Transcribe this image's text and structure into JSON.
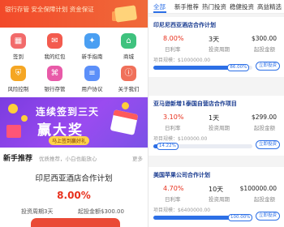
{
  "banner": {
    "slogan": "银行存管 安全保障计划 资金保证"
  },
  "icons": [
    {
      "label": "签到",
      "icon": "calendar-icon",
      "color": "#f26b6b",
      "glyph": "▦"
    },
    {
      "label": "我的红包",
      "icon": "red-packet-icon",
      "color": "#f35b4e",
      "glyph": "✉"
    },
    {
      "label": "新手指南",
      "icon": "guide-icon",
      "color": "#4a9ff2",
      "glyph": "✦"
    },
    {
      "label": "商城",
      "icon": "shop-icon",
      "color": "#3fc27e",
      "glyph": "⌂"
    },
    {
      "label": "风险控制",
      "icon": "shield-icon",
      "color": "#f5a623",
      "glyph": "⛨"
    },
    {
      "label": "银行存管",
      "icon": "bank-icon",
      "color": "#e85aa8",
      "glyph": "⌘"
    },
    {
      "label": "用户协议",
      "icon": "document-icon",
      "color": "#5b8ff9",
      "glyph": "≡"
    },
    {
      "label": "关于我们",
      "icon": "info-icon",
      "color": "#f0705a",
      "glyph": "ⓘ"
    }
  ],
  "promo": {
    "line1": "连续签到三天",
    "line2": "赢大奖",
    "badge": "马上签到赢好礼"
  },
  "recommend": {
    "title": "新手推荐",
    "subtitle": "优质推荐，小白也能放心",
    "more": "更多",
    "name": "印尼西亚酒店合作计划",
    "rate": "8.00%",
    "period": "投资周期3天",
    "min_amount": "起投金额$300.00"
  },
  "tabs": [
    {
      "label": "全部",
      "active": true
    },
    {
      "label": "新手推荐",
      "active": false
    },
    {
      "label": "热门投资",
      "active": false
    },
    {
      "label": "稳健投资",
      "active": false
    },
    {
      "label": "高益精选",
      "active": false
    }
  ],
  "products": [
    {
      "title": "印尼尼西亚酒店合作计划",
      "rate": "8.00%",
      "days": "3天",
      "amount": "$300.00",
      "rate_label": "日利率",
      "days_label": "投资周期",
      "amount_label": "起投金额",
      "limit": "项目规模：$1000000.00",
      "progress": 0.86,
      "progress_text": "86.00%",
      "button": "立即投资"
    },
    {
      "title": "亚马逊新增1泰国自营店合作项目",
      "rate": "3.10%",
      "days": "1天",
      "amount": "$299.00",
      "rate_label": "日利率",
      "days_label": "投资周期",
      "amount_label": "起投金额",
      "limit": "项目规模：$100000.00",
      "progress": 0.1422,
      "progress_text": "14.22%",
      "button": "立即投资"
    },
    {
      "title": "美国苹果公司合作计划",
      "rate": "4.70%",
      "days": "10天",
      "amount": "$100000.00",
      "rate_label": "日利率",
      "days_label": "投资周期",
      "amount_label": "起投金额",
      "limit": "项目规模：$6400000.00",
      "progress": 1.0,
      "progress_text": "100.00%",
      "button": "立即投资"
    }
  ],
  "colors": {
    "accent": "#2c6fe6",
    "rate_red": "#e8301c",
    "banner_red": "#f24a2a"
  }
}
